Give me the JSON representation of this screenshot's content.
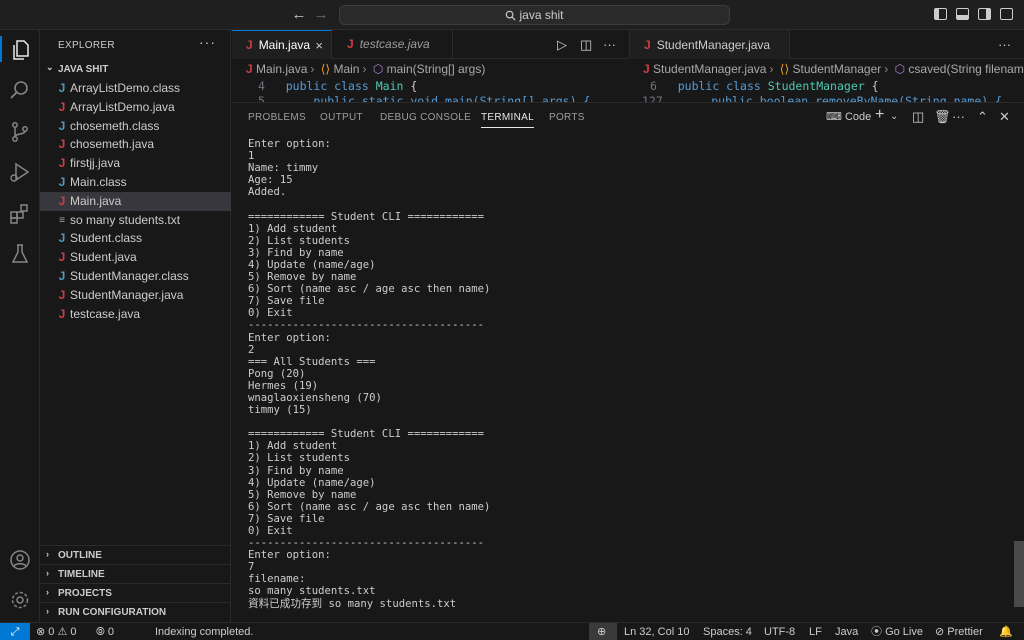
{
  "titlebar": {
    "search_text": "java shit"
  },
  "activity": [
    "explorer-icon",
    "search-icon",
    "source-control-icon",
    "run-debug-icon",
    "extensions-icon",
    "testing-icon",
    "account-icon",
    "settings-icon"
  ],
  "explorer": {
    "header": "EXPLORER",
    "folder": "JAVA SHIT",
    "files": [
      {
        "name": "ArrayListDemo.class",
        "kind": "class"
      },
      {
        "name": "ArrayListDemo.java",
        "kind": "java"
      },
      {
        "name": "chosemeth.class",
        "kind": "class"
      },
      {
        "name": "chosemeth.java",
        "kind": "java"
      },
      {
        "name": "firstjj.java",
        "kind": "java"
      },
      {
        "name": "Main.class",
        "kind": "class"
      },
      {
        "name": "Main.java",
        "kind": "java",
        "selected": true
      },
      {
        "name": "so many students.txt",
        "kind": "txt"
      },
      {
        "name": "Student.class",
        "kind": "class"
      },
      {
        "name": "Student.java",
        "kind": "java"
      },
      {
        "name": "StudentManager.class",
        "kind": "class"
      },
      {
        "name": "StudentManager.java",
        "kind": "java"
      },
      {
        "name": "testcase.java",
        "kind": "java"
      }
    ],
    "sections": [
      "OUTLINE",
      "TIMELINE",
      "PROJECTS",
      "RUN CONFIGURATION"
    ]
  },
  "editor_left": {
    "tabs": [
      "Main.java",
      "testcase.java"
    ],
    "breadcrumb": [
      "Main.java",
      "Main",
      "main(String[] args)"
    ],
    "line_numbers": [
      "4",
      "5"
    ],
    "code": {
      "l1_kw": "public class ",
      "l1_type": "Main",
      "l1_rest": " {",
      "l2": "    public static void main(String[] args) {"
    }
  },
  "editor_right": {
    "tab": "StudentManager.java",
    "breadcrumb": [
      "StudentManager.java",
      "StudentManager",
      "csaved(String filenam"
    ],
    "line_numbers": [
      "6",
      "127"
    ],
    "code": {
      "l1_kw": "public class ",
      "l1_type": "StudentManager",
      "l1_rest": " {",
      "l2": "    public boolean removeByName(String name) {"
    }
  },
  "panel": {
    "tabs": [
      "PROBLEMS",
      "OUTPUT",
      "DEBUG CONSOLE",
      "TERMINAL",
      "PORTS"
    ],
    "active_tab": "TERMINAL",
    "terminal_label": "Code",
    "terminal_lines": [
      "Enter option:",
      "1",
      "Name: timmy",
      "Age: 15",
      "Added.",
      "",
      "============ Student CLI ============",
      "1) Add student",
      "2) List students",
      "3) Find by name",
      "4) Update (name/age)",
      "5) Remove by name",
      "6) Sort (name asc / age asc then name)",
      "7) Save file",
      "0) Exit",
      "-------------------------------------",
      "Enter option:",
      "2",
      "=== All Students ===",
      "Pong (20)",
      "Hermes (19)",
      "wnaglaoxiensheng (70)",
      "timmy (15)",
      "",
      "============ Student CLI ============",
      "1) Add student",
      "2) List students",
      "3) Find by name",
      "4) Update (name/age)",
      "5) Remove by name",
      "6) Sort (name asc / age asc then name)",
      "7) Save file",
      "0) Exit",
      "-------------------------------------",
      "Enter option:",
      "7",
      "filename:",
      "so many students.txt",
      "資料已成功存到 so many students.txt"
    ]
  },
  "status": {
    "errors": "0",
    "warnings": "0",
    "ports": "0",
    "message": "Indexing completed.",
    "position": "Ln 32, Col 10",
    "spaces": "Spaces: 4",
    "encoding": "UTF-8",
    "eol": "LF",
    "language": "Java",
    "golive": "Go Live",
    "prettier": "Prettier"
  },
  "colors": {
    "accent": "#0078d4",
    "java_icon": "#cc3e44",
    "class_icon": "#519aba"
  }
}
